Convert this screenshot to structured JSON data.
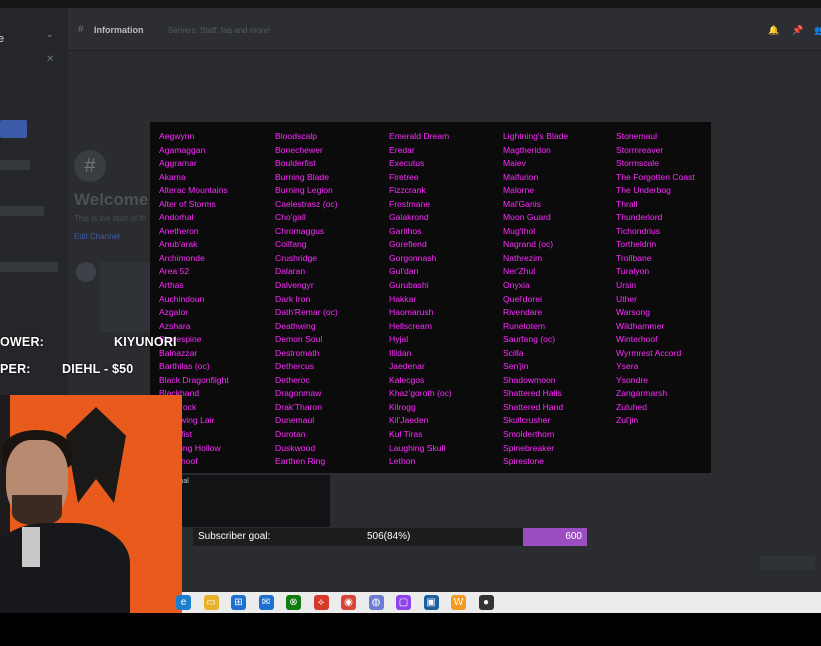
{
  "discord": {
    "channel": "Information",
    "topic": "Servers, Staff, faq and more!",
    "welcome": "Welcome",
    "welcome_sub": "This is the start of th",
    "edit_link": "Edit Channel"
  },
  "commands": {
    "col1": [
      "Aegwynn",
      "Agamaggan",
      "Aggramar",
      "Akama",
      "Alterac Mountains",
      "Alter of Storms",
      "Andorhal",
      "Anetheron",
      "Anub'arak",
      "Archimonde",
      "Area 52",
      "Arthas",
      "Auchindoun",
      "Azgalor",
      "Azshara",
      "Bladespine",
      "Balnazzar",
      "Barthilas (oc)",
      "Black Dragonflight",
      "Blackhand",
      "Blackrock",
      "Blackwing Lair",
      "Bladefist",
      "Bleeding Hollow",
      "Bloodhoof"
    ],
    "col2": [
      "Bloodscalp",
      "Bonechewer",
      "Boulderfist",
      "Burning Blade",
      "Burning Legion",
      "Caelestrasz (oc)",
      "Cho'gall",
      "Chromaggus",
      "Coilfang",
      "Crushridge",
      "Dalaran",
      "Dalvengyr",
      "Dark Iron",
      "Dath'Remar (oc)",
      "Deathwing",
      "Demon Soul",
      "Destromath",
      "Dethercus",
      "Detheroc",
      "Dragonmaw",
      "Drak'Tharon",
      "Dunemaul",
      "Durotan",
      "Duskwood",
      "Earthen Ring"
    ],
    "col3": [
      "Emerald Dream",
      "Eredar",
      "Executus",
      "Firetree",
      "Fizzcrank",
      "Frostmane",
      "Galakrond",
      "Garithos",
      "Gorefiend",
      "Gorgonnash",
      "Gul'dan",
      "Gurubashi",
      "Hakkar",
      "Haomarush",
      "Hellscream",
      "Hyjal",
      "Illidan",
      "Jaedenar",
      "Kalecgos",
      "Khaz'goroth (oc)",
      "Kilrogg",
      "Kil'Jaeden",
      "Kul Tiras",
      "Laughing Skull",
      "Lethon"
    ],
    "col4": [
      "Lightning's Blade",
      "Magtheridon",
      "Maiev",
      "Malfurion",
      "Malorne",
      "Mal'Ganis",
      "Moon Guard",
      "Mug'thol",
      "Nagrand (oc)",
      "Nathrezim",
      "Ner'Zhul",
      "Onyxia",
      "Quel'dorei",
      "Rivendare",
      "Runetotem",
      "Saurfang (oc)",
      "Scilla",
      "Sen'jin",
      "Shadowmoon",
      "Shattered Halls",
      "Shattered Hand",
      "Skullcrusher",
      "Smolderthorn",
      "Spinebreaker",
      "Spirestone"
    ],
    "col5": [
      "Stonemaul",
      "Stormreaver",
      "Stormscale",
      "The Forgotten Coast",
      "The Underbog",
      "Thrall",
      "Thunderlord",
      "Tichondrius",
      "Tortheldrin",
      "Trollbane",
      "Turalyon",
      "Ursin",
      "Uther",
      "Warsong",
      "Wildhammer",
      "Winterhoof",
      "Wyrmrest Accord",
      "Ysera",
      "Ysondre",
      "Zangarmarsh",
      "Zuluhed",
      "Zul'jin"
    ]
  },
  "stream": {
    "follower_label": "OWER:",
    "follower_name": "KIYUNORI",
    "tipper_label": "PER:",
    "tipper_value": "DIEHL - $50",
    "mini_panel_title": "ginal"
  },
  "goal": {
    "label": "Subscriber goal:",
    "current": "506(84%)",
    "target": "600",
    "progress_percent": 84,
    "bar_color": "#9b4ec1"
  },
  "taskbar_icons": [
    "edge-icon",
    "file-explorer-icon",
    "store-icon",
    "mail-icon",
    "xbox-icon",
    "game-icon",
    "chrome-icon",
    "discord-icon",
    "twitch-icon",
    "app-icon",
    "blizzard-icon",
    "obs-icon"
  ]
}
